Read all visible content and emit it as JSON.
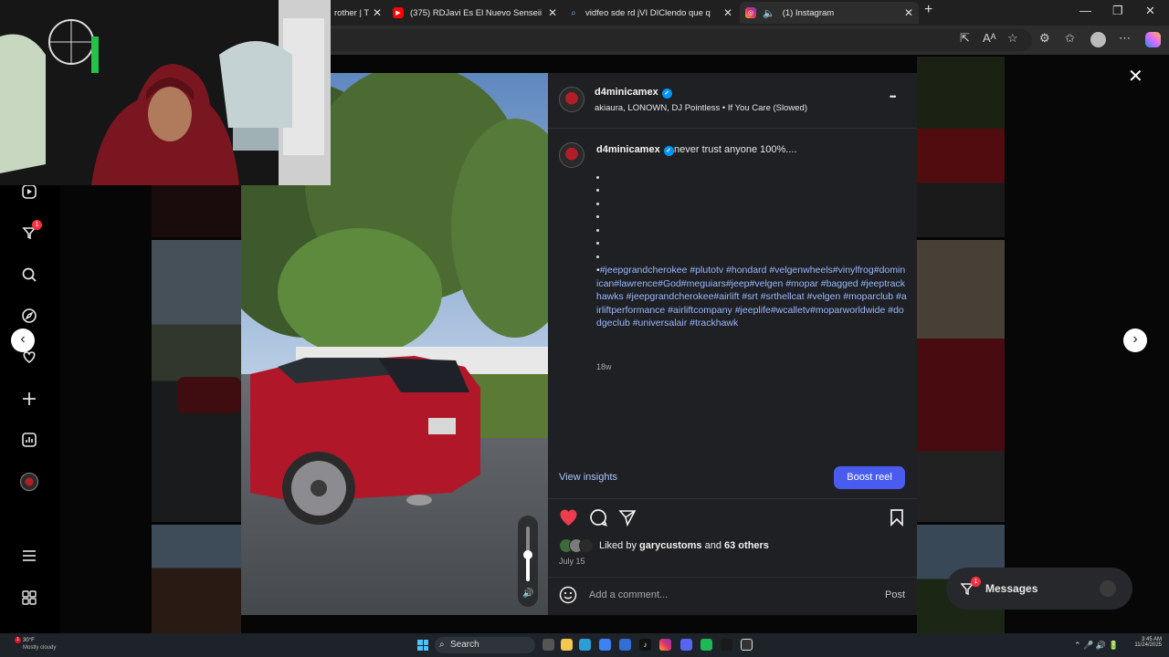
{
  "browser": {
    "tabs": [
      {
        "title": "rother | T",
        "favicon": "twitch-icon"
      },
      {
        "title": "(375) RDJavi Es El Nuevo Senseii",
        "favicon": "youtube-icon"
      },
      {
        "title": "vidfeo sde rd jVI DIClendo que q",
        "favicon": "search-icon"
      },
      {
        "title": "(1) Instagram",
        "favicon": "instagram-icon",
        "active": true
      }
    ]
  },
  "nav": {
    "notification_badge": "1"
  },
  "post": {
    "username": "d4minicamex",
    "audio": "akiaura, LONOWN, DJ Pointless • If You Care (Slowed)",
    "more": "•••",
    "caption_user": "d4minicamex",
    "caption_text": "never trust anyone 100%....",
    "bullets": [
      "•",
      "•",
      "•",
      "•",
      "•",
      "•",
      "•"
    ],
    "last_bullet": "•",
    "hashtags": "#jeepgrandcherokee #plutotv #hondard #velgenwheels#vinylfrog#dominican#lawrence#God#meguiars#jeep#velgen #mopar #bagged #jeeptrackhawks #jeepgrandcherokee#airlift #srt #srthellcat #velgen #moparclub #airliftperformance #airliftcompany #jeeplife#wcalletv#moparworldwide #dodgeclub #universalair #trackhawk",
    "age": "18w",
    "view_insights": "View insights",
    "boost_label": "Boost reel",
    "liked_by_prefix": "Liked by",
    "liked_by_user": "garycustoms",
    "liked_by_and": "and",
    "liked_by_others": "63 others",
    "date": "July 15",
    "comment_placeholder": "Add a comment...",
    "post_button": "Post"
  },
  "messages": {
    "label": "Messages",
    "badge": "1"
  },
  "taskbar": {
    "weather_temp": "30°F",
    "weather_desc": "Mostly cloudy",
    "weather_badge": "1",
    "search_label": "Search",
    "time": "3:45 AM",
    "date": "11/24/2025"
  },
  "colors": {
    "like": "#ed3c4d",
    "accent": "#4a5cf0",
    "hashtag": "#99b7ff",
    "panel": "#1f2023"
  }
}
